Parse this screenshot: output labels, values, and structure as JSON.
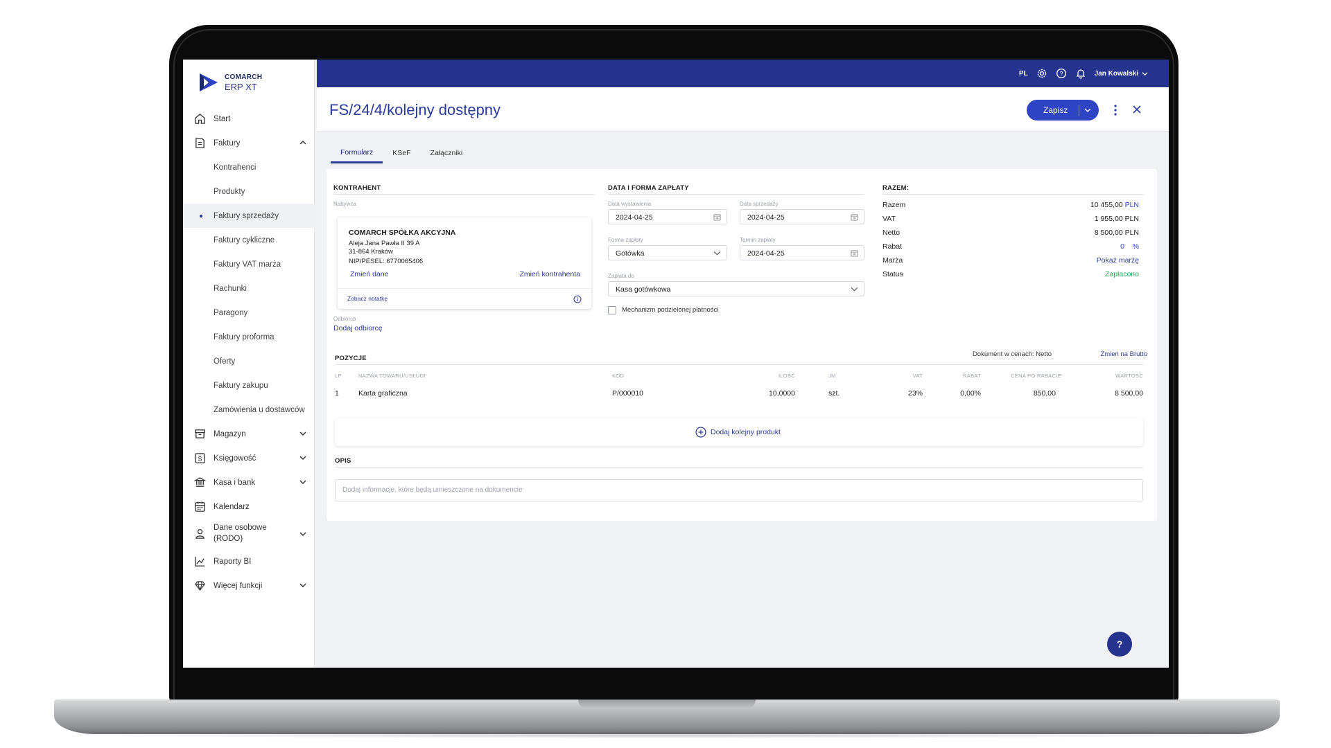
{
  "colors": {
    "brand": "#25338f",
    "accent": "#2f44c4",
    "link": "#2b3a9a",
    "paid": "#2eaa5a",
    "sidebar_bg": "#ffffff"
  },
  "logo": {
    "brand": "COMARCH",
    "product": "ERP XT"
  },
  "topbar": {
    "language": "PL",
    "user_name": "Jan Kowalski",
    "icons": [
      "settings-icon",
      "help-icon",
      "bell-icon"
    ]
  },
  "sidebar": {
    "items": [
      {
        "label": "Start",
        "icon": "home-icon"
      },
      {
        "label": "Faktury",
        "icon": "invoice-icon",
        "expanded": true
      },
      {
        "label": "Kontrahenci"
      },
      {
        "label": "Produkty"
      },
      {
        "label": "Faktury sprzedaży",
        "active": true
      },
      {
        "label": "Faktury cykliczne"
      },
      {
        "label": "Faktury VAT marża"
      },
      {
        "label": "Rachunki"
      },
      {
        "label": "Paragony"
      },
      {
        "label": "Faktury proforma"
      },
      {
        "label": "Oferty"
      },
      {
        "label": "Faktury zakupu"
      },
      {
        "label": "Zamówienia u dostawców"
      },
      {
        "label": "Magazyn",
        "icon": "warehouse-icon"
      },
      {
        "label": "Księgowość",
        "icon": "accounting-icon"
      },
      {
        "label": "Kasa i bank",
        "icon": "bank-icon"
      },
      {
        "label": "Kalendarz",
        "icon": "calendar-icon"
      },
      {
        "label": "Dane osobowe (RODO)",
        "icon": "person-icon"
      },
      {
        "label": "Raporty BI",
        "icon": "chart-icon"
      },
      {
        "label": "Więcej funkcji",
        "icon": "diamond-icon"
      }
    ]
  },
  "header": {
    "title": "FS/24/4/kolejny dostępny",
    "save_label": "Zapisz"
  },
  "tabs": [
    {
      "label": "Formularz",
      "active": true
    },
    {
      "label": "KSeF"
    },
    {
      "label": "Załączniki"
    }
  ],
  "kontrahent": {
    "heading": "KONTRAHENT",
    "buyer_label": "Nabywca",
    "name": "COMARCH SPÓŁKA AKCYJNA",
    "address1": "Aleja Jana Pawła II 39 A",
    "address2": "31-864 Kraków",
    "nip": "NIP/PESEL: 6770065406",
    "change_data": "Zmień dane",
    "change_contractor": "Zmień kontrahenta",
    "see_note": "Zobacz notatkę",
    "recipient_label": "Odbiorca",
    "add_recipient": "Dodaj odbiorcę"
  },
  "payment": {
    "heading": "DATA I FORMA ZAPŁATY",
    "issue_date_label": "Data wystawienia",
    "issue_date": "2024-04-25",
    "sale_date_label": "Data sprzedaży",
    "sale_date": "2024-04-25",
    "method_label": "Forma zapłaty",
    "method": "Gotówka",
    "due_label": "Termin zapłaty",
    "due_date": "2024-04-25",
    "pay_to_label": "Zapłata do",
    "pay_to": "Kasa gotówkowa",
    "split_payment": "Mechanizm podzielonej płatności"
  },
  "totals": {
    "heading": "RAZEM:",
    "rows": [
      {
        "label": "Razem",
        "value": "10 455,00",
        "unit": "PLN"
      },
      {
        "label": "VAT",
        "value": "1 955,00 PLN"
      },
      {
        "label": "Netto",
        "value": "8 500,00 PLN"
      },
      {
        "label": "Rabat",
        "value": "0",
        "unit": "%"
      },
      {
        "label": "Marża",
        "value": "Pokaż marżę"
      },
      {
        "label": "Status",
        "value": "Zapłacono"
      }
    ]
  },
  "positions": {
    "heading": "POZYCJE",
    "price_mode": "Dokument w cenach: Netto",
    "change_mode": "Zmień na Brutto",
    "columns": [
      "LP",
      "NAZWA TOWARU/USŁUGI",
      "KOD",
      "ILOŚĆ",
      "JM",
      "VAT",
      "RABAT",
      "CENA PO RABACIE",
      "WARTOŚĆ"
    ],
    "rows": [
      {
        "lp": "1",
        "name": "Karta graficzna",
        "code": "P/000010",
        "qty": "10,0000",
        "unit": "szt.",
        "vat": "23%",
        "discount": "0,00%",
        "price": "850,00",
        "value": "8 500,00"
      }
    ],
    "add_product": "Dodaj kolejny produkt"
  },
  "description": {
    "heading": "OPIS",
    "placeholder": "Dodaj informacje, które będą umieszczone na dokumencie"
  },
  "help": {
    "label": "?"
  }
}
